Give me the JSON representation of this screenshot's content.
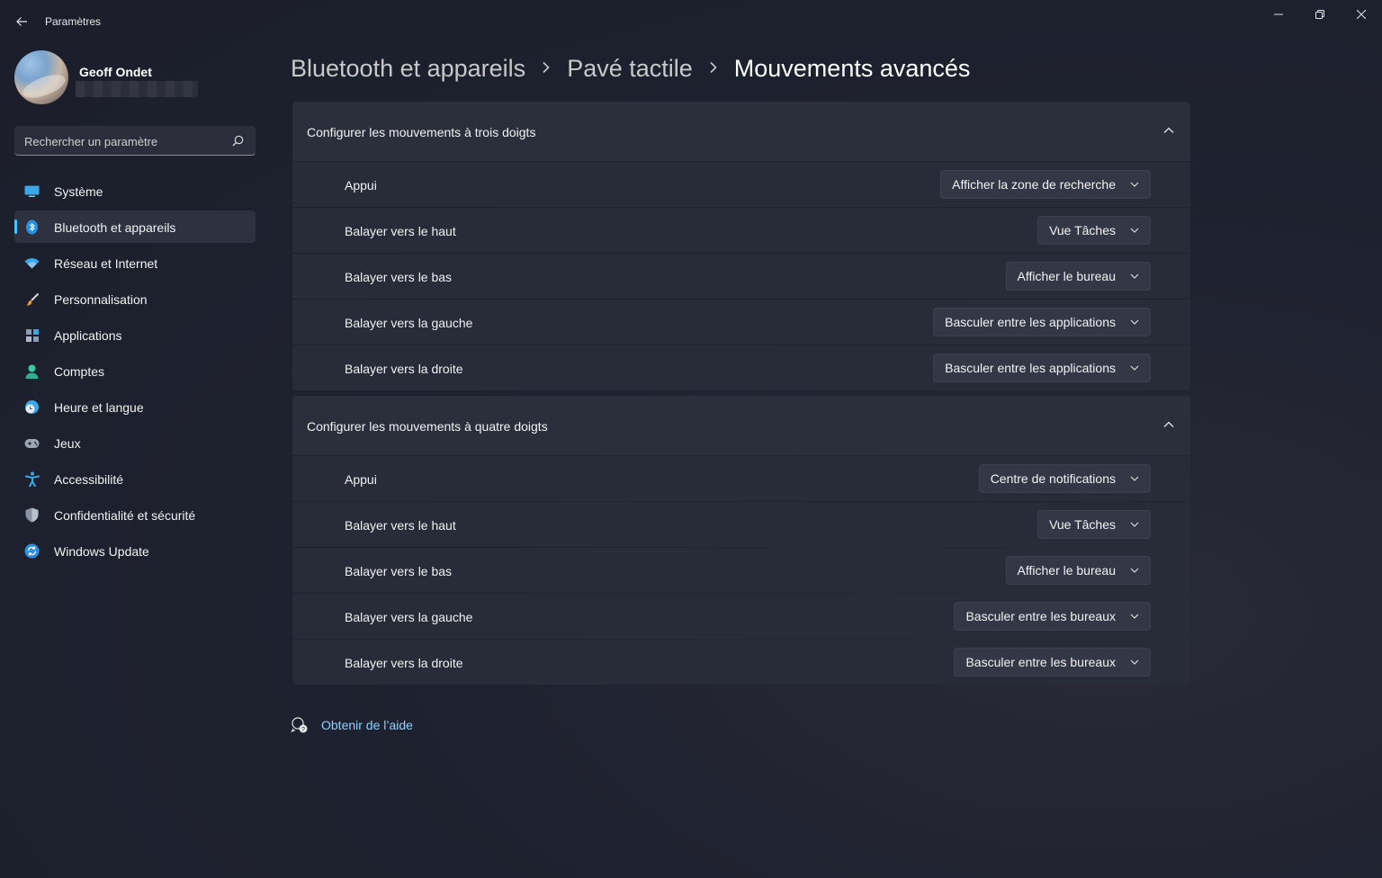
{
  "window": {
    "title": "Paramètres"
  },
  "profile": {
    "name": "Geoff Ondet"
  },
  "search": {
    "placeholder": "Rechercher un paramètre"
  },
  "sidebar": {
    "items": [
      {
        "label": "Système",
        "icon": "monitor-icon"
      },
      {
        "label": "Bluetooth et appareils",
        "icon": "bluetooth-icon",
        "active": true
      },
      {
        "label": "Réseau et Internet",
        "icon": "wifi-icon"
      },
      {
        "label": "Personnalisation",
        "icon": "brush-icon"
      },
      {
        "label": "Applications",
        "icon": "apps-icon"
      },
      {
        "label": "Comptes",
        "icon": "person-icon"
      },
      {
        "label": "Heure et langue",
        "icon": "clock-globe-icon"
      },
      {
        "label": "Jeux",
        "icon": "gamepad-icon"
      },
      {
        "label": "Accessibilité",
        "icon": "accessibility-icon"
      },
      {
        "label": "Confidentialité et sécurité",
        "icon": "shield-icon"
      },
      {
        "label": "Windows Update",
        "icon": "update-icon"
      }
    ]
  },
  "breadcrumb": {
    "items": [
      "Bluetooth et appareils",
      "Pavé tactile",
      "Mouvements avancés"
    ]
  },
  "three_fingers": {
    "title": "Configurer les mouvements à trois doigts",
    "rows": [
      {
        "label": "Appui",
        "value": "Afficher la zone de recherche"
      },
      {
        "label": "Balayer vers le haut",
        "value": "Vue Tâches"
      },
      {
        "label": "Balayer vers le bas",
        "value": "Afficher le bureau"
      },
      {
        "label": "Balayer vers la gauche",
        "value": "Basculer entre les applications"
      },
      {
        "label": "Balayer vers la droite",
        "value": "Basculer entre les applications"
      }
    ]
  },
  "four_fingers": {
    "title": "Configurer les mouvements à quatre doigts",
    "rows": [
      {
        "label": "Appui",
        "value": "Centre de notifications"
      },
      {
        "label": "Balayer vers le haut",
        "value": "Vue Tâches"
      },
      {
        "label": "Balayer vers le bas",
        "value": "Afficher le bureau"
      },
      {
        "label": "Balayer vers la gauche",
        "value": "Basculer entre les bureaux"
      },
      {
        "label": "Balayer vers la droite",
        "value": "Basculer entre les bureaux"
      }
    ]
  },
  "help": {
    "label": "Obtenir de l’aide"
  },
  "colors": {
    "accent": "#4cc2ff",
    "link": "#8fd0ff",
    "card": "#282b38"
  }
}
